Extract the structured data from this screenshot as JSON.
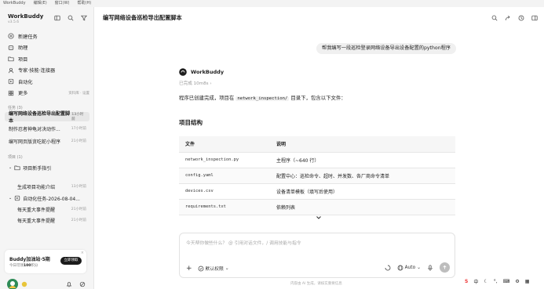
{
  "menu": {
    "app": "WorkBuddy",
    "edit": "编辑(E)",
    "window": "窗口(W)",
    "help": "帮助(H)"
  },
  "sidebar": {
    "brand": "WorkBuddy",
    "version": "v3.5.6",
    "nav": [
      "新建任务",
      "助理",
      "项目",
      "专家·技能·连接器",
      "自动化",
      "更多"
    ],
    "more_hint": "资料库 · 设置",
    "tasks_label": "任务 (3)",
    "tasks": [
      {
        "title": "编写网络设备巡检导出配置脚本",
        "time": "13小时前"
      },
      {
        "title": "制作忍者神龟对决动作...",
        "time": "17小时前"
      },
      {
        "title": "编写网页版贪吃蛇小程序",
        "time": "21小时前"
      }
    ],
    "projects_label": "项目 (1)",
    "project": "项目新手指引",
    "project_sub": "生成项目功能介绍",
    "project_sub_time": "13小时前",
    "auto": "自动化任务-2026-08-04...",
    "auto_items": [
      {
        "title": "每天重大事件提醒",
        "time": "21小时前"
      },
      {
        "title": "每天重大事件提醒",
        "time": "21小时前"
      }
    ],
    "promo": {
      "title": "Buddy加油站·5期",
      "subtitle_pre": "今日可领",
      "subtitle_num": "100",
      "subtitle_post": "积分",
      "button": "立即领取"
    }
  },
  "main": {
    "title": "编写网络设备巡检导出配置脚本",
    "user_message": "帮我编写一段巡检登录网络设备导出设备配置的python程序",
    "agent": "WorkBuddy",
    "status": "已完成 10m8s",
    "intro_pre": "程序已创建完成，项目在 ",
    "intro_code": "network_inspection/",
    "intro_post": " 目录下，包含以下文件：",
    "section": "项目结构",
    "table": {
      "headers": [
        "文件",
        "说明"
      ],
      "rows": [
        {
          "file": "network_inspection.py",
          "desc": "主程序（~640 行）"
        },
        {
          "file": "config.yaml",
          "desc": "配置中心：巡检命令、超时、并发数、各厂商命令清单"
        },
        {
          "file": "devices.csv",
          "desc": "设备清单模板（填写后使用）"
        },
        {
          "file": "requirements.txt",
          "desc": "依赖列表"
        }
      ]
    },
    "input_placeholder": "今天帮你做些什么？ @ 引用对话文件，/ 调用技能与指令",
    "permission": "默认权限",
    "auto": "Auto",
    "footer": "内容由 AI 生成，请核实重要信息"
  },
  "tray": {
    "ime": "中"
  }
}
